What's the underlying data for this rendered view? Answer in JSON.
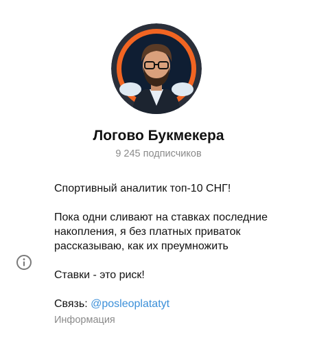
{
  "channel": {
    "name": "Логово Букмекера",
    "subscribers": "9 245 подписчиков",
    "avatar_icon": "avatar-bearded-man-with-glasses"
  },
  "info": {
    "icon": "info-icon",
    "paragraph_1": "Спортивный аналитик топ-10 СНГ!",
    "paragraph_2": "Пока одни сливают на ставках последние\nнакопления, я без платных приваток\nрассказываю, как их преумножить",
    "paragraph_3": "Ставки - это риск!",
    "contact_label": "Связь: ",
    "contact_handle": "@posleoplatatyt",
    "caption": "Информация"
  },
  "colors": {
    "ring": "#f26522",
    "avatar_bg": "#0f1e33",
    "link": "#3a8fd9",
    "muted": "#8a8a8a"
  }
}
